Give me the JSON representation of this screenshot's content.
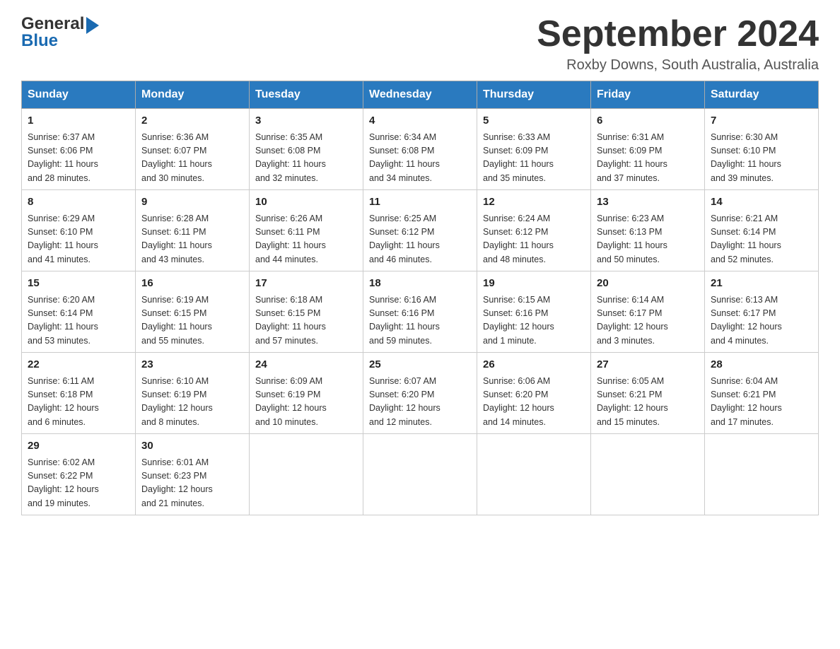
{
  "header": {
    "logo_general": "General",
    "logo_blue": "Blue",
    "month_title": "September 2024",
    "location": "Roxby Downs, South Australia, Australia"
  },
  "days_of_week": [
    "Sunday",
    "Monday",
    "Tuesday",
    "Wednesday",
    "Thursday",
    "Friday",
    "Saturday"
  ],
  "weeks": [
    [
      {
        "day": "1",
        "sunrise": "6:37 AM",
        "sunset": "6:06 PM",
        "daylight": "11 hours and 28 minutes."
      },
      {
        "day": "2",
        "sunrise": "6:36 AM",
        "sunset": "6:07 PM",
        "daylight": "11 hours and 30 minutes."
      },
      {
        "day": "3",
        "sunrise": "6:35 AM",
        "sunset": "6:08 PM",
        "daylight": "11 hours and 32 minutes."
      },
      {
        "day": "4",
        "sunrise": "6:34 AM",
        "sunset": "6:08 PM",
        "daylight": "11 hours and 34 minutes."
      },
      {
        "day": "5",
        "sunrise": "6:33 AM",
        "sunset": "6:09 PM",
        "daylight": "11 hours and 35 minutes."
      },
      {
        "day": "6",
        "sunrise": "6:31 AM",
        "sunset": "6:09 PM",
        "daylight": "11 hours and 37 minutes."
      },
      {
        "day": "7",
        "sunrise": "6:30 AM",
        "sunset": "6:10 PM",
        "daylight": "11 hours and 39 minutes."
      }
    ],
    [
      {
        "day": "8",
        "sunrise": "6:29 AM",
        "sunset": "6:10 PM",
        "daylight": "11 hours and 41 minutes."
      },
      {
        "day": "9",
        "sunrise": "6:28 AM",
        "sunset": "6:11 PM",
        "daylight": "11 hours and 43 minutes."
      },
      {
        "day": "10",
        "sunrise": "6:26 AM",
        "sunset": "6:11 PM",
        "daylight": "11 hours and 44 minutes."
      },
      {
        "day": "11",
        "sunrise": "6:25 AM",
        "sunset": "6:12 PM",
        "daylight": "11 hours and 46 minutes."
      },
      {
        "day": "12",
        "sunrise": "6:24 AM",
        "sunset": "6:12 PM",
        "daylight": "11 hours and 48 minutes."
      },
      {
        "day": "13",
        "sunrise": "6:23 AM",
        "sunset": "6:13 PM",
        "daylight": "11 hours and 50 minutes."
      },
      {
        "day": "14",
        "sunrise": "6:21 AM",
        "sunset": "6:14 PM",
        "daylight": "11 hours and 52 minutes."
      }
    ],
    [
      {
        "day": "15",
        "sunrise": "6:20 AM",
        "sunset": "6:14 PM",
        "daylight": "11 hours and 53 minutes."
      },
      {
        "day": "16",
        "sunrise": "6:19 AM",
        "sunset": "6:15 PM",
        "daylight": "11 hours and 55 minutes."
      },
      {
        "day": "17",
        "sunrise": "6:18 AM",
        "sunset": "6:15 PM",
        "daylight": "11 hours and 57 minutes."
      },
      {
        "day": "18",
        "sunrise": "6:16 AM",
        "sunset": "6:16 PM",
        "daylight": "11 hours and 59 minutes."
      },
      {
        "day": "19",
        "sunrise": "6:15 AM",
        "sunset": "6:16 PM",
        "daylight": "12 hours and 1 minute."
      },
      {
        "day": "20",
        "sunrise": "6:14 AM",
        "sunset": "6:17 PM",
        "daylight": "12 hours and 3 minutes."
      },
      {
        "day": "21",
        "sunrise": "6:13 AM",
        "sunset": "6:17 PM",
        "daylight": "12 hours and 4 minutes."
      }
    ],
    [
      {
        "day": "22",
        "sunrise": "6:11 AM",
        "sunset": "6:18 PM",
        "daylight": "12 hours and 6 minutes."
      },
      {
        "day": "23",
        "sunrise": "6:10 AM",
        "sunset": "6:19 PM",
        "daylight": "12 hours and 8 minutes."
      },
      {
        "day": "24",
        "sunrise": "6:09 AM",
        "sunset": "6:19 PM",
        "daylight": "12 hours and 10 minutes."
      },
      {
        "day": "25",
        "sunrise": "6:07 AM",
        "sunset": "6:20 PM",
        "daylight": "12 hours and 12 minutes."
      },
      {
        "day": "26",
        "sunrise": "6:06 AM",
        "sunset": "6:20 PM",
        "daylight": "12 hours and 14 minutes."
      },
      {
        "day": "27",
        "sunrise": "6:05 AM",
        "sunset": "6:21 PM",
        "daylight": "12 hours and 15 minutes."
      },
      {
        "day": "28",
        "sunrise": "6:04 AM",
        "sunset": "6:21 PM",
        "daylight": "12 hours and 17 minutes."
      }
    ],
    [
      {
        "day": "29",
        "sunrise": "6:02 AM",
        "sunset": "6:22 PM",
        "daylight": "12 hours and 19 minutes."
      },
      {
        "day": "30",
        "sunrise": "6:01 AM",
        "sunset": "6:23 PM",
        "daylight": "12 hours and 21 minutes."
      },
      null,
      null,
      null,
      null,
      null
    ]
  ],
  "labels": {
    "sunrise": "Sunrise:",
    "sunset": "Sunset:",
    "daylight": "Daylight:"
  }
}
